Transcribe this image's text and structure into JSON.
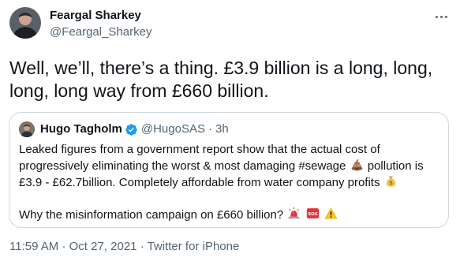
{
  "author": {
    "name": "Feargal Sharkey",
    "handle": "@Feargal_Sharkey"
  },
  "tweet": {
    "text": "Well, we’ll, there’s a thing. £3.9 billion is a long, long, long, long way from £660 billion."
  },
  "quoted": {
    "name": "Hugo Tagholm",
    "handle": "@HugoSAS",
    "separator": "·",
    "time": "3h",
    "line1": "Leaked figures from a government report show that the actual cost of",
    "line2a": "progressively eliminating the worst & most damaging #sewage",
    "line2b": "pollution is",
    "line3": "£3.9 - £62.7billion. Completely affordable from water company profits",
    "line4": "Why the misinformation campaign on £660 billion?"
  },
  "meta": {
    "time": "11:59 AM",
    "sep1": "·",
    "date": "Oct 27, 2021",
    "sep2": "·",
    "source": "Twitter for iPhone"
  },
  "icons": {
    "more": "more-horizontal-icon",
    "verified": "verified-badge-icon",
    "poop": "pile-of-poo-emoji",
    "money": "money-bag-emoji",
    "siren": "police-light-emoji",
    "sos": "sos-emoji",
    "warning": "warning-emoji"
  },
  "colors": {
    "text": "#0f1419",
    "secondary": "#536471",
    "border": "#cfd9de",
    "verified": "#1d9bf0"
  }
}
